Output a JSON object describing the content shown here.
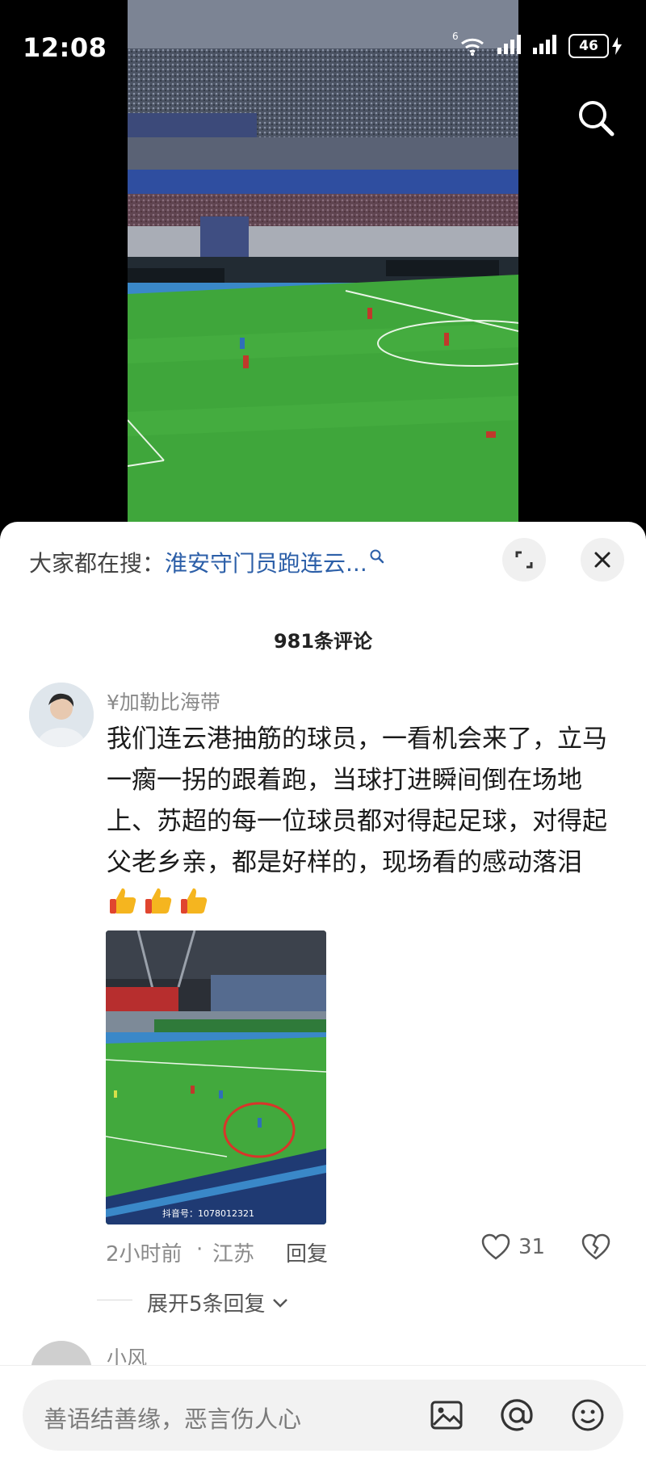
{
  "status_bar": {
    "time": "12:08",
    "battery": "46",
    "wifi_superscript": "6"
  },
  "sheet": {
    "search_hint_prefix": "大家都在搜：",
    "search_hint_query": "淮安守门员跑连云...",
    "comment_count": "981条评论"
  },
  "comment": {
    "username": "¥加勒比海带",
    "text": "我们连云港抽筋的球员，一看机会来了，立马一瘸一拐的跟着跑，当球打进瞬间倒在场地上、苏超的每一位球员都对得起足球，对得起父老乡亲，都是好样的，现场看的感动落泪",
    "image_watermark": "抖音号：1078012321",
    "time_ago": "2小时前",
    "location": "江苏",
    "separator": "·",
    "reply_label": "回复",
    "likes": "31",
    "expand_replies_label": "展开5条回复"
  },
  "next_comment": {
    "username": "小风"
  },
  "input": {
    "placeholder": "善语结善缘，恶言伤人心"
  },
  "icons": [
    "search-icon",
    "expand-icon",
    "close-icon",
    "heart-icon",
    "broken-heart-icon",
    "image-icon",
    "at-icon",
    "emoji-icon",
    "thumbs-up-icon",
    "chevron-down-icon"
  ],
  "colors": {
    "query_link": "#2c5fa8",
    "pitch_green": "#3fa63b",
    "sheet_bg": "#ffffff"
  }
}
